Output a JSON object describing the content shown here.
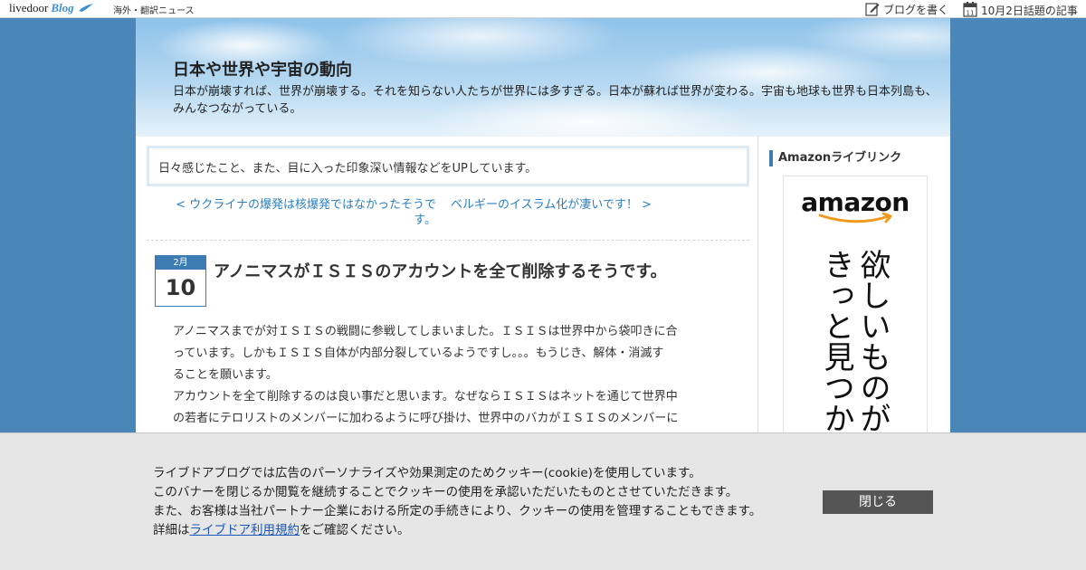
{
  "topbar": {
    "logo_text": "livedoor",
    "logo_blog": "Blog",
    "category": "海外・翻訳ニュース",
    "write_blog": "ブログを書く",
    "topics": "10月2日話題の記事",
    "calendar_day": "11"
  },
  "header": {
    "title": "日本や世界や宇宙の動向",
    "description": "日本が崩壊すれば、世界が崩壊する。それを知らない人たちが世界には多すぎる。日本が蘇れば世界が変わる。宇宙も地球も世界も日本列島も、みんなつながっている。"
  },
  "main": {
    "intro": "日々感じたこと、また、目に入った印象深い情報などをUPしています。",
    "prev_link": "< ウクライナの爆発は核爆発ではなかったそうです。",
    "next_link": "ベルギーのイスラム化が凄いです！ >",
    "post": {
      "month": "2月",
      "day": "10",
      "title": "アノニマスがＩＳＩＳのアカウントを全て削除するそうです。",
      "body_lines": [
        "アノニマスまでが対ＩＳＩＳの戦闘に参戦してしまいました。ＩＳＩＳは世界中から袋叩きに合",
        "っています。しかもＩＳＩＳ自体が内部分裂しているようですし。。。もうじき、解体・消滅す",
        "ることを願います。",
        "アカウントを全て削除するのは良い事だと思います。なぜならＩＳＩＳはネットを通じて世界中",
        "の若者にテロリストのメンバーに加わるように呼び掛け、世界中のバカがＩＳＩＳのメンバーに"
      ]
    }
  },
  "sidebar": {
    "heading": "Amazonライブリンク",
    "ad": {
      "brand": "amazon",
      "col1": "欲しいものが",
      "col2": "きっと見つか"
    }
  },
  "cookie": {
    "line1": "ライブドアブログでは広告のパーソナライズや効果測定のためクッキー(cookie)を使用しています。",
    "line2": "このバナーを閉じるか閲覧を継続することでクッキーの使用を承認いただいたものとさせていただきます。",
    "line3": "また、お客様は当社パートナー企業における所定の手続きにより、クッキーの使用を管理することもできます。",
    "line4_prefix": "詳細は",
    "line4_link": "ライブドア利用規約",
    "line4_suffix": "をご確認ください。",
    "close_label": "閉じる"
  },
  "colors": {
    "page_bg": "#4a86b8",
    "accent": "#3d7cb3",
    "link": "#2c7fbf",
    "close_button": "#555555"
  }
}
